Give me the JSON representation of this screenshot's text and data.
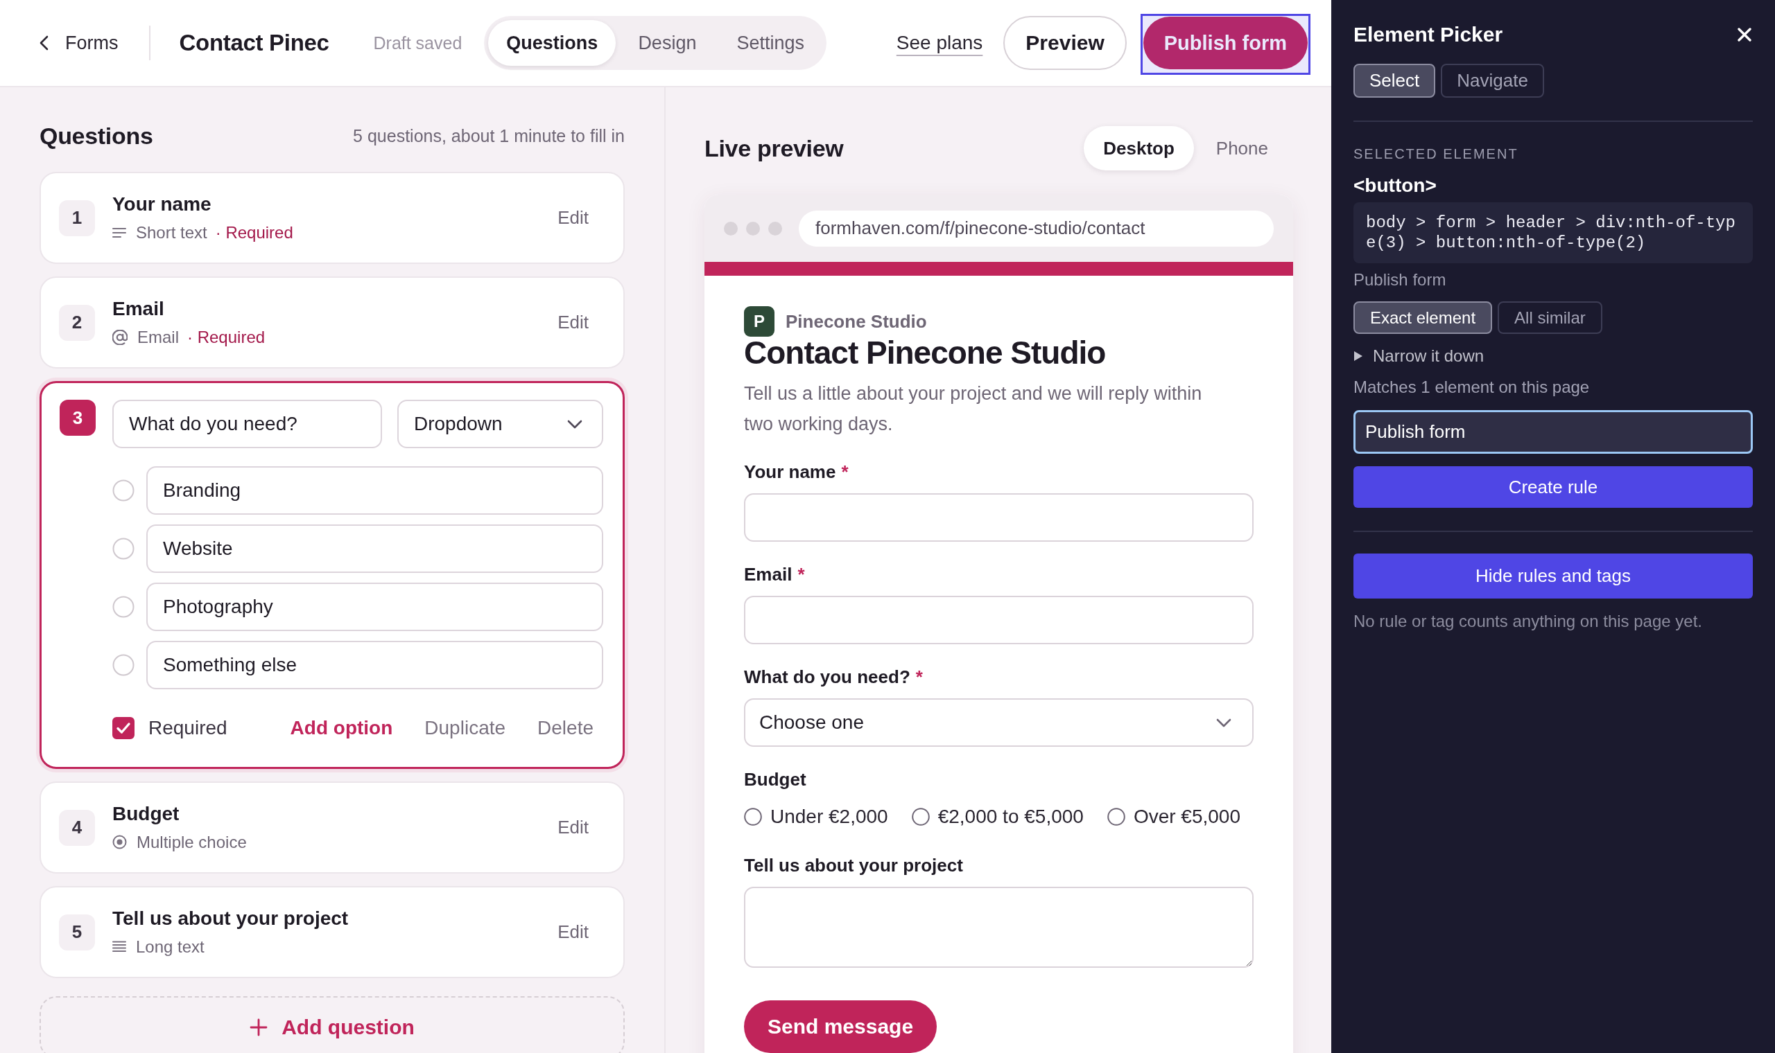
{
  "header": {
    "back_link": "Forms",
    "form_title": "Contact Pinec",
    "save_status": "Draft saved",
    "tabs": [
      {
        "label": "Questions",
        "selected": true
      },
      {
        "label": "Design",
        "selected": false
      },
      {
        "label": "Settings",
        "selected": false
      }
    ],
    "plans_link": "See plans",
    "preview_button": "Preview",
    "publish_button": {
      "label": "Publish form",
      "highlighted": true
    }
  },
  "questions_panel": {
    "title": "Questions",
    "summary": "5 questions, about 1 minute to fill in",
    "questions": [
      {
        "number": "1",
        "expanded": false,
        "kind": "short_text",
        "title": "Your name",
        "type_label": "Short text",
        "tag": "· Required",
        "edit": "Edit"
      },
      {
        "number": "2",
        "expanded": false,
        "kind": "email",
        "title": "Email",
        "type_label": "Email",
        "tag": "· Required",
        "edit": "Edit"
      },
      {
        "number": "3",
        "expanded": true,
        "title": "What do you need?",
        "type_label": "Dropdown",
        "required": true,
        "required_label": "Required",
        "options": [
          "Branding",
          "Website",
          "Photography",
          "Something else"
        ],
        "actions": [
          {
            "kind": "add",
            "label": "Add option"
          },
          {
            "kind": "duplicate",
            "label": "Duplicate"
          },
          {
            "kind": "delete",
            "label": "Delete"
          }
        ]
      },
      {
        "number": "4",
        "expanded": false,
        "kind": "multiple_choice",
        "title": "Budget",
        "type_label": "Multiple choice",
        "edit": "Edit"
      },
      {
        "number": "5",
        "expanded": false,
        "kind": "long_text",
        "title": "Tell us about your project",
        "type_label": "Long text",
        "edit": "Edit"
      }
    ],
    "add_button": "Add question"
  },
  "preview": {
    "title": "Live preview",
    "devices": [
      {
        "label": "Desktop",
        "selected": true
      },
      {
        "label": "Phone",
        "selected": false
      }
    ],
    "url": "formhaven.com/f/pinecone-studio/contact",
    "form": {
      "brand_initial": "P",
      "brand_name": "Pinecone Studio",
      "title": "Contact Pinecone Studio",
      "description": "Tell us a little about your project and we will reply within two working days.",
      "required_mark": "*",
      "fields": [
        {
          "kind": "text",
          "label": "Your name",
          "required": true
        },
        {
          "kind": "text",
          "label": "Email",
          "required": true
        },
        {
          "kind": "select",
          "label": "What do you need?",
          "required": true,
          "placeholder": "Choose one"
        },
        {
          "kind": "radio",
          "label": "Budget",
          "required": false,
          "options": [
            {
              "label": "Under €2,000",
              "selected": false
            },
            {
              "label": "€2,000 to €5,000",
              "selected": false
            },
            {
              "label": "Over €5,000",
              "selected": false
            }
          ]
        },
        {
          "kind": "textarea",
          "label": "Tell us about your project",
          "required": false
        }
      ],
      "submit": "Send message"
    }
  },
  "picker": {
    "title": "Element Picker",
    "modes": [
      {
        "label": "Select",
        "selected": true
      },
      {
        "label": "Navigate",
        "selected": false
      }
    ],
    "section_label": "SELECTED ELEMENT",
    "element_tag": "<button>",
    "selector": "body > form > header > div:nth-of-type(3) > button:nth-of-type(2)",
    "element_text": "Publish form",
    "scopes": [
      {
        "label": "Exact element",
        "selected": true
      },
      {
        "label": "All similar",
        "selected": false
      }
    ],
    "narrow": {
      "label": "Narrow it down",
      "expanded": false
    },
    "match_count": "Matches 1 element on this page",
    "name_input": {
      "value": "Publish form",
      "focused": true
    },
    "create_button": "Create rule",
    "toggle_button": "Hide rules and tags",
    "footer_note": "No rule or tag counts anything on this page yet."
  }
}
